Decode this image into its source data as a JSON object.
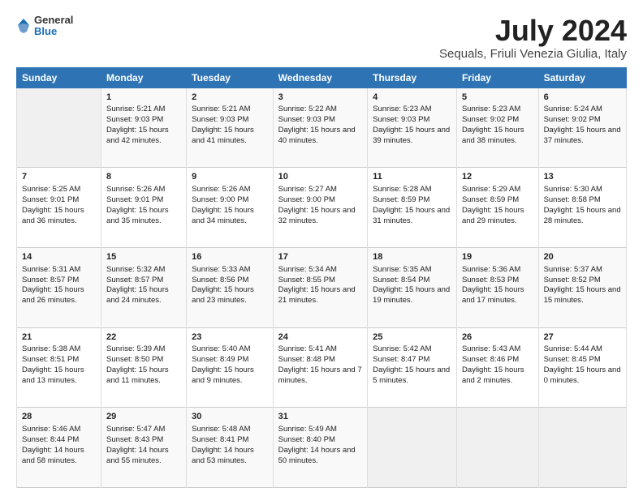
{
  "header": {
    "logo": {
      "general": "General",
      "blue": "Blue"
    },
    "title": "July 2024",
    "subtitle": "Sequals, Friuli Venezia Giulia, Italy"
  },
  "days_of_week": [
    "Sunday",
    "Monday",
    "Tuesday",
    "Wednesday",
    "Thursday",
    "Friday",
    "Saturday"
  ],
  "weeks": [
    [
      {
        "day": "",
        "content": ""
      },
      {
        "day": "1",
        "sunrise": "Sunrise: 5:21 AM",
        "sunset": "Sunset: 9:03 PM",
        "daylight": "Daylight: 15 hours and 42 minutes."
      },
      {
        "day": "2",
        "sunrise": "Sunrise: 5:21 AM",
        "sunset": "Sunset: 9:03 PM",
        "daylight": "Daylight: 15 hours and 41 minutes."
      },
      {
        "day": "3",
        "sunrise": "Sunrise: 5:22 AM",
        "sunset": "Sunset: 9:03 PM",
        "daylight": "Daylight: 15 hours and 40 minutes."
      },
      {
        "day": "4",
        "sunrise": "Sunrise: 5:23 AM",
        "sunset": "Sunset: 9:03 PM",
        "daylight": "Daylight: 15 hours and 39 minutes."
      },
      {
        "day": "5",
        "sunrise": "Sunrise: 5:23 AM",
        "sunset": "Sunset: 9:02 PM",
        "daylight": "Daylight: 15 hours and 38 minutes."
      },
      {
        "day": "6",
        "sunrise": "Sunrise: 5:24 AM",
        "sunset": "Sunset: 9:02 PM",
        "daylight": "Daylight: 15 hours and 37 minutes."
      }
    ],
    [
      {
        "day": "7",
        "sunrise": "Sunrise: 5:25 AM",
        "sunset": "Sunset: 9:01 PM",
        "daylight": "Daylight: 15 hours and 36 minutes."
      },
      {
        "day": "8",
        "sunrise": "Sunrise: 5:26 AM",
        "sunset": "Sunset: 9:01 PM",
        "daylight": "Daylight: 15 hours and 35 minutes."
      },
      {
        "day": "9",
        "sunrise": "Sunrise: 5:26 AM",
        "sunset": "Sunset: 9:00 PM",
        "daylight": "Daylight: 15 hours and 34 minutes."
      },
      {
        "day": "10",
        "sunrise": "Sunrise: 5:27 AM",
        "sunset": "Sunset: 9:00 PM",
        "daylight": "Daylight: 15 hours and 32 minutes."
      },
      {
        "day": "11",
        "sunrise": "Sunrise: 5:28 AM",
        "sunset": "Sunset: 8:59 PM",
        "daylight": "Daylight: 15 hours and 31 minutes."
      },
      {
        "day": "12",
        "sunrise": "Sunrise: 5:29 AM",
        "sunset": "Sunset: 8:59 PM",
        "daylight": "Daylight: 15 hours and 29 minutes."
      },
      {
        "day": "13",
        "sunrise": "Sunrise: 5:30 AM",
        "sunset": "Sunset: 8:58 PM",
        "daylight": "Daylight: 15 hours and 28 minutes."
      }
    ],
    [
      {
        "day": "14",
        "sunrise": "Sunrise: 5:31 AM",
        "sunset": "Sunset: 8:57 PM",
        "daylight": "Daylight: 15 hours and 26 minutes."
      },
      {
        "day": "15",
        "sunrise": "Sunrise: 5:32 AM",
        "sunset": "Sunset: 8:57 PM",
        "daylight": "Daylight: 15 hours and 24 minutes."
      },
      {
        "day": "16",
        "sunrise": "Sunrise: 5:33 AM",
        "sunset": "Sunset: 8:56 PM",
        "daylight": "Daylight: 15 hours and 23 minutes."
      },
      {
        "day": "17",
        "sunrise": "Sunrise: 5:34 AM",
        "sunset": "Sunset: 8:55 PM",
        "daylight": "Daylight: 15 hours and 21 minutes."
      },
      {
        "day": "18",
        "sunrise": "Sunrise: 5:35 AM",
        "sunset": "Sunset: 8:54 PM",
        "daylight": "Daylight: 15 hours and 19 minutes."
      },
      {
        "day": "19",
        "sunrise": "Sunrise: 5:36 AM",
        "sunset": "Sunset: 8:53 PM",
        "daylight": "Daylight: 15 hours and 17 minutes."
      },
      {
        "day": "20",
        "sunrise": "Sunrise: 5:37 AM",
        "sunset": "Sunset: 8:52 PM",
        "daylight": "Daylight: 15 hours and 15 minutes."
      }
    ],
    [
      {
        "day": "21",
        "sunrise": "Sunrise: 5:38 AM",
        "sunset": "Sunset: 8:51 PM",
        "daylight": "Daylight: 15 hours and 13 minutes."
      },
      {
        "day": "22",
        "sunrise": "Sunrise: 5:39 AM",
        "sunset": "Sunset: 8:50 PM",
        "daylight": "Daylight: 15 hours and 11 minutes."
      },
      {
        "day": "23",
        "sunrise": "Sunrise: 5:40 AM",
        "sunset": "Sunset: 8:49 PM",
        "daylight": "Daylight: 15 hours and 9 minutes."
      },
      {
        "day": "24",
        "sunrise": "Sunrise: 5:41 AM",
        "sunset": "Sunset: 8:48 PM",
        "daylight": "Daylight: 15 hours and 7 minutes."
      },
      {
        "day": "25",
        "sunrise": "Sunrise: 5:42 AM",
        "sunset": "Sunset: 8:47 PM",
        "daylight": "Daylight: 15 hours and 5 minutes."
      },
      {
        "day": "26",
        "sunrise": "Sunrise: 5:43 AM",
        "sunset": "Sunset: 8:46 PM",
        "daylight": "Daylight: 15 hours and 2 minutes."
      },
      {
        "day": "27",
        "sunrise": "Sunrise: 5:44 AM",
        "sunset": "Sunset: 8:45 PM",
        "daylight": "Daylight: 15 hours and 0 minutes."
      }
    ],
    [
      {
        "day": "28",
        "sunrise": "Sunrise: 5:46 AM",
        "sunset": "Sunset: 8:44 PM",
        "daylight": "Daylight: 14 hours and 58 minutes."
      },
      {
        "day": "29",
        "sunrise": "Sunrise: 5:47 AM",
        "sunset": "Sunset: 8:43 PM",
        "daylight": "Daylight: 14 hours and 55 minutes."
      },
      {
        "day": "30",
        "sunrise": "Sunrise: 5:48 AM",
        "sunset": "Sunset: 8:41 PM",
        "daylight": "Daylight: 14 hours and 53 minutes."
      },
      {
        "day": "31",
        "sunrise": "Sunrise: 5:49 AM",
        "sunset": "Sunset: 8:40 PM",
        "daylight": "Daylight: 14 hours and 50 minutes."
      },
      {
        "day": "",
        "content": ""
      },
      {
        "day": "",
        "content": ""
      },
      {
        "day": "",
        "content": ""
      }
    ]
  ]
}
